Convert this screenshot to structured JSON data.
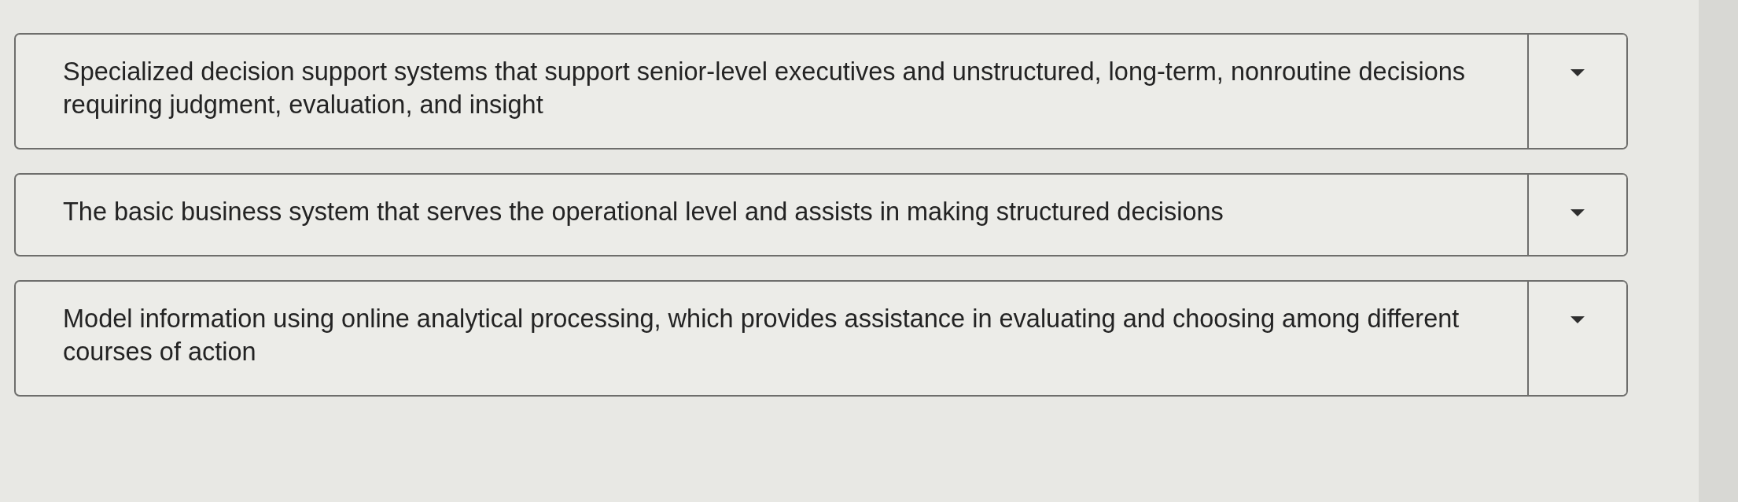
{
  "matching_items": [
    {
      "statement": "Specialized decision support systems that support senior-level executives and unstructured, long-term, nonroutine decisions requiring judgment, evaluation, and insight"
    },
    {
      "statement": "The basic business system that serves the operational level and assists in making structured decisions"
    },
    {
      "statement": "Model information using online analytical processing, which provides assistance in evaluating and choosing among different courses of action"
    }
  ]
}
